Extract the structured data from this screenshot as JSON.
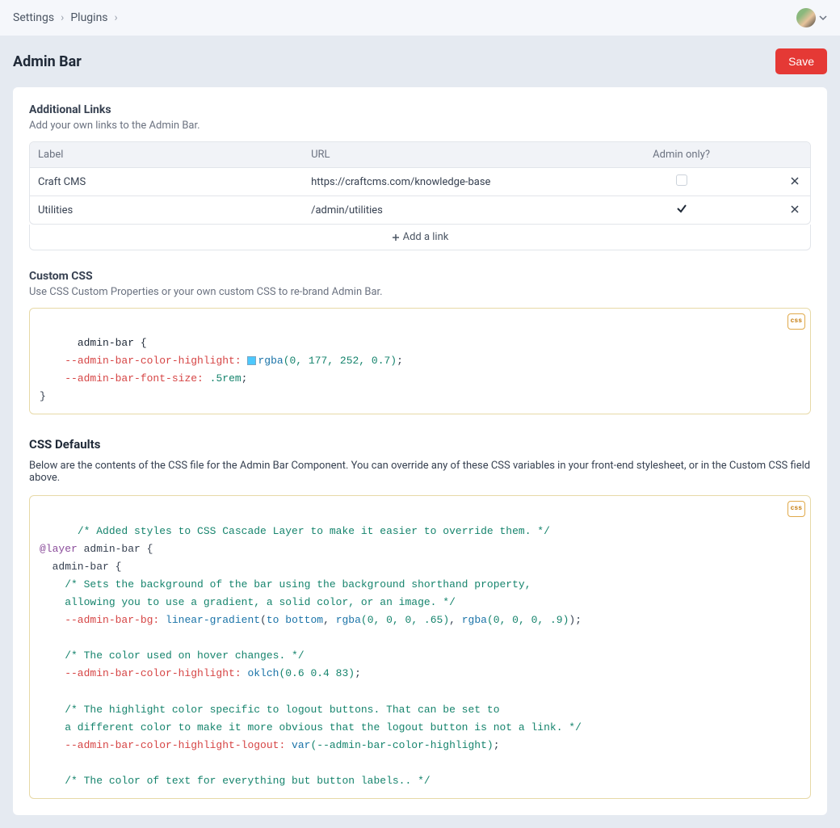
{
  "breadcrumbs": {
    "item0": "Settings",
    "sep": "›",
    "item1": "Plugins"
  },
  "page": {
    "title": "Admin Bar",
    "save_label": "Save"
  },
  "additional_links": {
    "title": "Additional Links",
    "desc": "Add your own links to the Admin Bar.",
    "headers": {
      "label": "Label",
      "url": "URL",
      "admin_only": "Admin only?"
    },
    "rows": [
      {
        "label": "Craft CMS",
        "url": "https://craftcms.com/knowledge-base",
        "admin_only": false
      },
      {
        "label": "Utilities",
        "url": "/admin/utilities",
        "admin_only": true
      }
    ],
    "add_label": "Add a link"
  },
  "custom_css": {
    "title": "Custom CSS",
    "desc": "Use CSS Custom Properties or your own custom CSS to re-brand Admin Bar.",
    "badge": "css",
    "code": {
      "l1_sel": "admin-bar {",
      "l2_var": "--admin-bar-color-highlight:",
      "l2_func": "rgba",
      "l2_args": "(0, 177, 252, 0.7)",
      "l2_end": ";",
      "l3_var": "--admin-bar-font-size:",
      "l3_val": " .5rem",
      "l3_end": ";",
      "l4": "}"
    }
  },
  "css_defaults": {
    "title": "CSS Defaults",
    "desc": "Below are the contents of the CSS file for the Admin Bar Component. You can override any of these CSS variables in your front-end stylesheet, or in the Custom CSS field above.",
    "badge": "css",
    "code": {
      "l1": "/* Added styles to CSS Cascade Layer to make it easier to override them. */",
      "l2_kw": "@layer",
      "l2_name": " admin-bar {",
      "l3": "  admin-bar {",
      "l4": "    /* Sets the background of the bar using the background shorthand property,",
      "l5": "    allowing you to use a gradient, a solid color, or an image. */",
      "l6_var": "    --admin-bar-bg:",
      "l6_func1": " linear-gradient",
      "l6_mid1": "(",
      "l6_kw1": "to bottom",
      "l6_mid2": ", ",
      "l6_func2": "rgba",
      "l6_args1": "(0, 0, 0, .65)",
      "l6_mid3": ", ",
      "l6_func3": "rgba",
      "l6_args2": "(0, 0, 0, .9)",
      "l6_end": ");",
      "l8": "    /* The color used on hover changes. */",
      "l9_var": "    --admin-bar-color-highlight:",
      "l9_func": " oklch",
      "l9_args": "(0.6 0.4 83)",
      "l9_end": ";",
      "l11": "    /* The highlight color specific to logout buttons. That can be set to",
      "l12": "    a different color to make it more obvious that the logout button is not a link. */",
      "l13_var": "    --admin-bar-color-highlight-logout:",
      "l13_func": " var",
      "l13_args": "(--admin-bar-color-highlight)",
      "l13_end": ";",
      "l15": "    /* The color of text for everything but button labels.. */"
    }
  }
}
